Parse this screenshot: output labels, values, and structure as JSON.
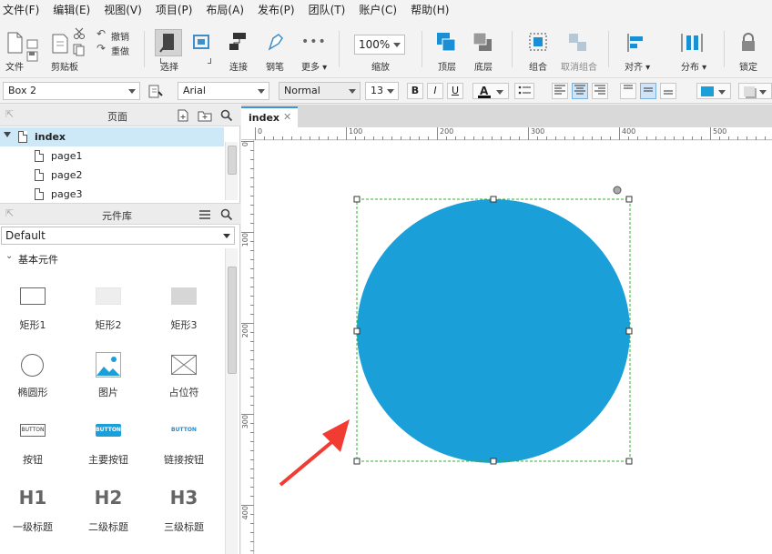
{
  "menubar": {
    "items": [
      "文件(F)",
      "编辑(E)",
      "视图(V)",
      "项目(P)",
      "布局(A)",
      "发布(P)",
      "团队(T)",
      "账户(C)",
      "帮助(H)"
    ]
  },
  "toolbar": {
    "file": "文件",
    "clipboard": "剪贴板",
    "undo": "撤销",
    "redo": "重做",
    "select": "选择",
    "connect": "连接",
    "pen": "钢笔",
    "more": "更多",
    "zoom_value": "100%",
    "zoom_label": "缩放",
    "top": "顶层",
    "bottom": "底层",
    "group": "组合",
    "ungroup": "取消组合",
    "align": "对齐",
    "distribute": "分布",
    "lock": "锁定"
  },
  "formatbar": {
    "widget_name": "Box 2",
    "font": "Arial",
    "weight": "Normal",
    "size": "13",
    "bold": "B",
    "italic": "I",
    "underline": "U",
    "font_color_letter": "A",
    "fill_color": "#1a9fd9"
  },
  "pages_panel": {
    "title": "页面",
    "pages": [
      {
        "name": "index",
        "selected": true
      },
      {
        "name": "page1"
      },
      {
        "name": "page2"
      },
      {
        "name": "page3"
      }
    ]
  },
  "library_panel": {
    "title": "元件库",
    "library": "Default",
    "group": "基本元件",
    "widgets": [
      {
        "label": "矩形1",
        "icon": "rectangle-icon"
      },
      {
        "label": "矩形2",
        "icon": "rectangle-light-icon"
      },
      {
        "label": "矩形3",
        "icon": "rectangle-gray-icon"
      },
      {
        "label": "椭圆形",
        "icon": "ellipse-icon"
      },
      {
        "label": "图片",
        "icon": "image-icon"
      },
      {
        "label": "占位符",
        "icon": "placeholder-icon"
      },
      {
        "label": "按钮",
        "icon": "button-icon",
        "text": "BUTTON"
      },
      {
        "label": "主要按钮",
        "icon": "primary-button-icon",
        "text": "BUTTON"
      },
      {
        "label": "链接按钮",
        "icon": "link-button-icon",
        "text": "BUTTON"
      },
      {
        "label": "一级标题",
        "icon": "h1-icon",
        "text": "H1"
      },
      {
        "label": "二级标题",
        "icon": "h2-icon",
        "text": "H2"
      },
      {
        "label": "三级标题",
        "icon": "h3-icon",
        "text": "H3"
      }
    ]
  },
  "editor": {
    "tab": "index",
    "ruler_top": [
      "0",
      "100",
      "200",
      "300",
      "400",
      "500"
    ],
    "ruler_left": [
      "0",
      "100",
      "200",
      "300",
      "400"
    ],
    "circle_color": "#1a9fd9",
    "selection_color": "#2db52d",
    "arrow_color": "#f03c32"
  }
}
